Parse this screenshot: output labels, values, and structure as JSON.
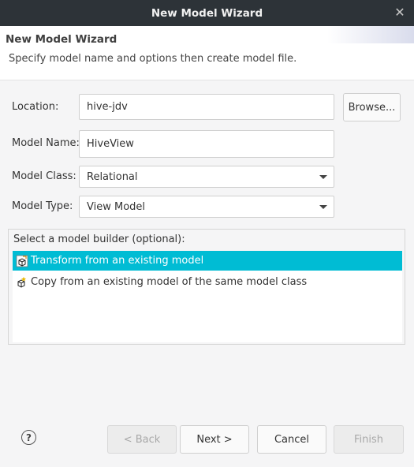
{
  "window": {
    "title": "New Model Wizard",
    "close_glyph": "✕"
  },
  "header": {
    "title": "New Model Wizard",
    "description": "Specify model name and options then create model file."
  },
  "form": {
    "location_label": "Location:",
    "location_value": "hive-jdv",
    "browse_label": "Browse...",
    "model_name_label": "Model Name:",
    "model_name_value": "HiveView",
    "model_class_label": "Model Class:",
    "model_class_value": "Relational",
    "model_type_label": "Model Type:",
    "model_type_value": "View Model"
  },
  "builder": {
    "title": "Select a model builder (optional):",
    "items": [
      {
        "label": "Transform from an existing model",
        "icon": "transform-icon",
        "selected": true
      },
      {
        "label": "Copy from an existing model of the same model class",
        "icon": "copy-model-icon",
        "selected": false
      }
    ]
  },
  "footer": {
    "help_glyph": "?",
    "back_label": "< Back",
    "next_label": "Next >",
    "cancel_label": "Cancel",
    "finish_label": "Finish"
  },
  "colors": {
    "selection": "#00bcd4",
    "titlebar": "#2d3338"
  }
}
